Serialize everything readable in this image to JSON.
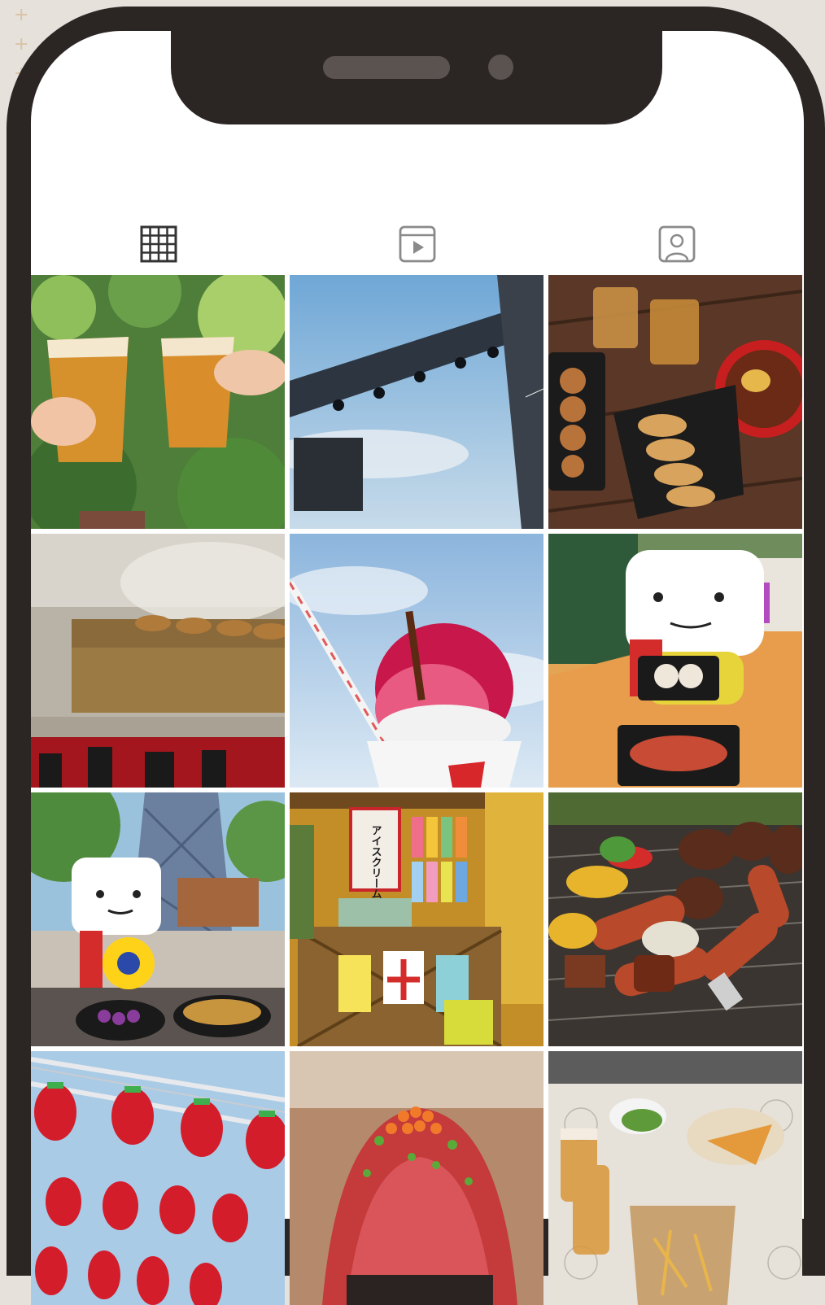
{
  "tabs": [
    {
      "id": "posts",
      "icon": "grid-icon",
      "active": true
    },
    {
      "id": "reels",
      "icon": "reels-play-icon",
      "active": false
    },
    {
      "id": "tagged",
      "icon": "tagged-user-icon",
      "active": false
    }
  ],
  "photos": [
    {
      "subject": "beer-toast"
    },
    {
      "subject": "stage-truss"
    },
    {
      "subject": "yakitori-gyoza-tray"
    },
    {
      "subject": "yakitori-grill"
    },
    {
      "subject": "shaved-ice"
    },
    {
      "subject": "mascot-with-dumplings"
    },
    {
      "subject": "mascot-under-tower"
    },
    {
      "subject": "festival-food-stall",
      "sign_text": "アイスクリーム"
    },
    {
      "subject": "bbq-grill"
    },
    {
      "subject": "red-lanterns"
    },
    {
      "subject": "seafood-bowl"
    },
    {
      "subject": "pizza-and-beer-table"
    }
  ],
  "colors": {
    "phone_frame": "#2b2624",
    "background": "#e6e1da",
    "screen": "#ffffff",
    "icon_active": "#333333",
    "icon_inactive": "#8a8a8a"
  }
}
